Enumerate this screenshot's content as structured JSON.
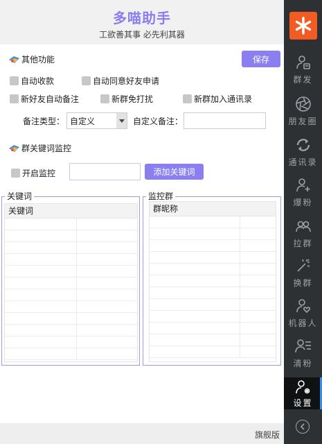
{
  "app": {
    "title": "多喵助手",
    "slogan": "工欲善其事  必先利其器",
    "edition": "旗舰版"
  },
  "other_functions": {
    "title": "其他功能",
    "save_label": "保存",
    "auto_receive": "自动收款",
    "auto_accept_friend": "自动同意好友申请",
    "new_friend_auto_remark": "新好友自动备注",
    "new_group_mute": "新群免打扰",
    "new_group_add_contacts": "新群加入通讯录",
    "remark_type_label": "备注类型：",
    "remark_type_value": "自定义",
    "custom_remark_label": "自定义备注：",
    "custom_remark_value": ""
  },
  "keyword_monitor": {
    "title": "群关键词监控",
    "enable_label": "开启监控",
    "keyword_input_value": "",
    "add_keyword_label": "添加关键词",
    "keywords_group": {
      "legend": "关键词",
      "column": "关键词"
    },
    "monitor_group": {
      "legend": "监控群",
      "column": "群昵称"
    }
  },
  "sidebar": {
    "items": [
      {
        "label": "群发",
        "icon": "broadcast-person-icon"
      },
      {
        "label": "朋友圈",
        "icon": "aperture-icon"
      },
      {
        "label": "通讯录",
        "icon": "sync-icon"
      },
      {
        "label": "爆粉",
        "icon": "add-user-icon"
      },
      {
        "label": "拉群",
        "icon": "group-icon"
      },
      {
        "label": "换群",
        "icon": "magic-wand-icon"
      },
      {
        "label": "机器人",
        "icon": "user-heart-icon"
      },
      {
        "label": "清粉",
        "icon": "user-list-icon"
      },
      {
        "label": "设置",
        "icon": "user-gear-icon"
      }
    ]
  },
  "colors": {
    "accent": "#8a7ef0",
    "sidebar_bg": "#2e3133",
    "logo_bg": "#f25c24",
    "active_indicator": "#3b8fe3"
  }
}
